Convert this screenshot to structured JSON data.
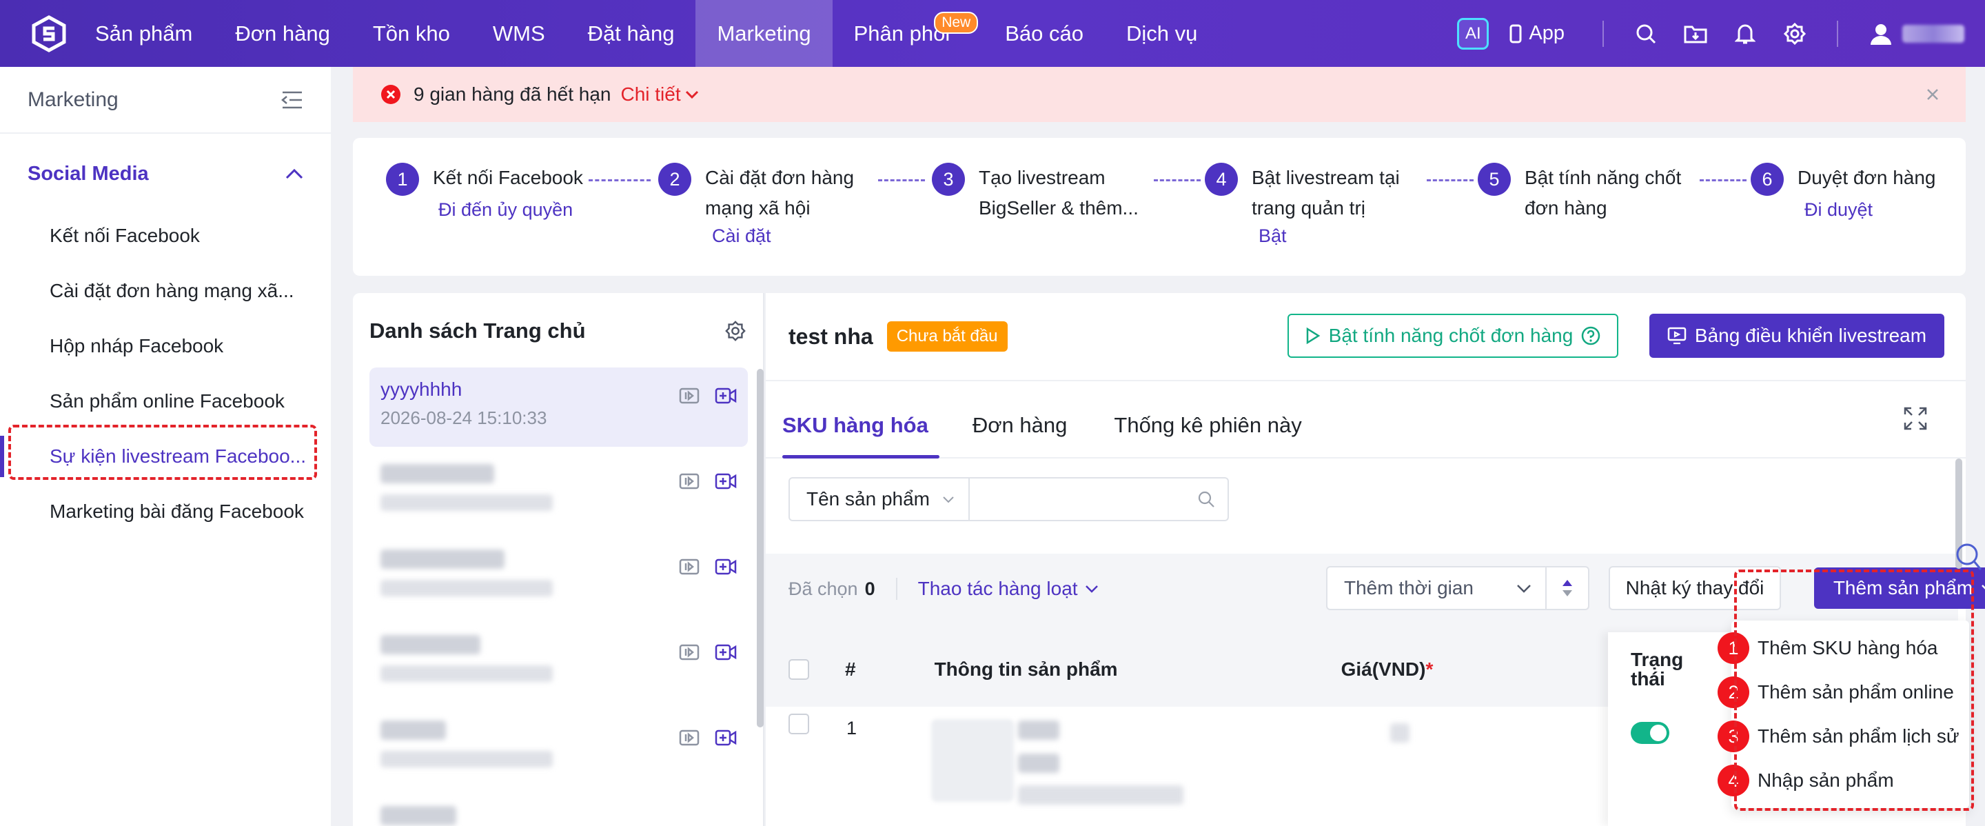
{
  "topnav": {
    "items": [
      "Sản phẩm",
      "Đơn hàng",
      "Tồn kho",
      "WMS",
      "Đặt hàng",
      "Marketing",
      "Phân phối",
      "Báo cáo",
      "Dịch vụ"
    ],
    "active": "Marketing",
    "new_badge": "New",
    "ai_label": "AI",
    "app_label": "App",
    "brand_color": "#4d33c2"
  },
  "sidebar": {
    "title": "Marketing",
    "group": "Social Media",
    "items": [
      "Kết nối Facebook",
      "Cài đặt đơn hàng mạng xã...",
      "Hộp nháp Facebook",
      "Sản phẩm online Facebook",
      "Sự kiện livestream Faceboo...",
      "Marketing bài đăng Facebook"
    ],
    "active_index": 4
  },
  "alert": {
    "text": "9 gian hàng đã hết hạn",
    "link": "Chi tiết"
  },
  "steps": [
    {
      "num": "1",
      "line1": "Kết nối Facebook",
      "line2": "",
      "link": "Đi đến ủy quyền"
    },
    {
      "num": "2",
      "line1": "Cài đặt đơn hàng",
      "line2": "mạng xã hội",
      "link": "Cài đặt"
    },
    {
      "num": "3",
      "line1": "Tạo livestream",
      "line2": "BigSeller & thêm...",
      "link": ""
    },
    {
      "num": "4",
      "line1": "Bật livestream tại",
      "line2": "trang quản trị",
      "link": "Bật"
    },
    {
      "num": "5",
      "line1": "Bật tính năng chốt",
      "line2": "đơn hàng",
      "link": ""
    },
    {
      "num": "6",
      "line1": "Duyệt đơn hàng",
      "line2": "",
      "link": "Đi duyệt"
    }
  ],
  "list": {
    "title": "Danh sách Trang chủ",
    "first_item": {
      "name": "yyyyhhhh",
      "date": "2026-08-24 15:10:33"
    }
  },
  "main": {
    "event_name": "test nha",
    "status": "Chưa bắt đầu",
    "closing_button": "Bật tính năng chốt đơn hàng",
    "dashboard_button": "Bảng điều khiển livestream",
    "tabs": [
      "SKU hàng hóa",
      "Đơn hàng",
      "Thống kê phiên này"
    ],
    "filter_field": "Tên sản phẩm",
    "selected_label": "Đã chọn",
    "selected_count": "0",
    "batch_label": "Thao tác hàng loạt",
    "time_select": "Thêm thời gian",
    "log_button": "Nhật ký thay đổi",
    "add_button": "Thêm sản phẩm",
    "columns": {
      "index": "#",
      "product": "Thông tin sản phẩm",
      "price": "Giá(VND)",
      "required": "*",
      "status_l1": "Trạng",
      "status_l2": "thái"
    },
    "row_index": "1"
  },
  "dropdown": [
    {
      "num": "1",
      "label": "Thêm SKU hàng hóa"
    },
    {
      "num": "2",
      "label": "Thêm sản phẩm online"
    },
    {
      "num": "3",
      "label": "Thêm sản phẩm lịch sử"
    },
    {
      "num": "4",
      "label": "Nhập sản phẩm"
    }
  ]
}
